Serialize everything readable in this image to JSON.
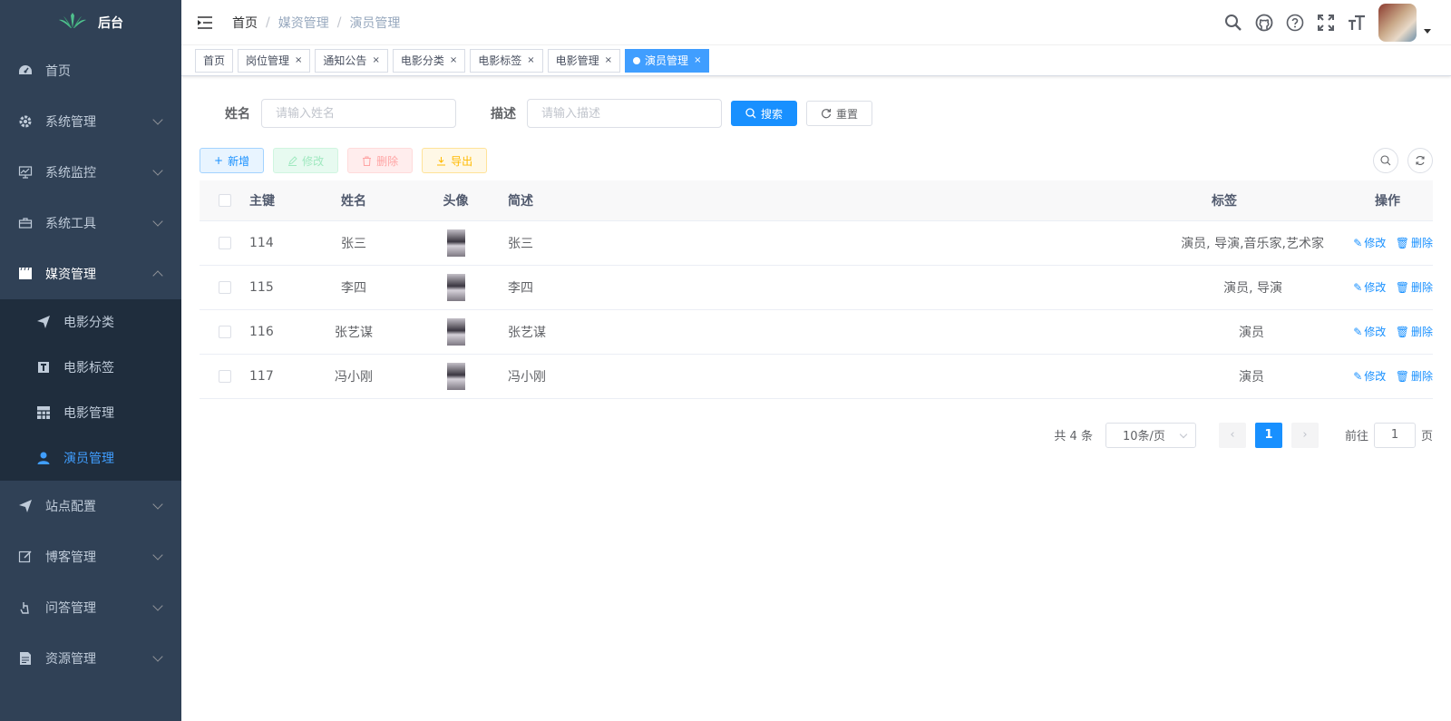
{
  "sidebar": {
    "logo_text": "后台",
    "items": [
      {
        "label": "首页",
        "icon": "dashboard-icon"
      },
      {
        "label": "系统管理",
        "icon": "gear-icon"
      },
      {
        "label": "系统监控",
        "icon": "monitor-icon"
      },
      {
        "label": "系统工具",
        "icon": "toolbox-icon"
      },
      {
        "label": "媒资管理",
        "icon": "clapperboard-icon"
      },
      {
        "label": "站点配置",
        "icon": "paper-plane-icon"
      },
      {
        "label": "博客管理",
        "icon": "edit-icon"
      },
      {
        "label": "问答管理",
        "icon": "hand-icon"
      },
      {
        "label": "资源管理",
        "icon": "document-icon"
      }
    ],
    "sub_items": [
      {
        "label": "电影分类",
        "icon": "paper-plane-icon"
      },
      {
        "label": "电影标签",
        "icon": "text-icon"
      },
      {
        "label": "电影管理",
        "icon": "grid-icon"
      },
      {
        "label": "演员管理",
        "icon": "user-icon"
      }
    ]
  },
  "navbar": {
    "breadcrumb": [
      "首页",
      "媒资管理",
      "演员管理"
    ],
    "icons": [
      "search-icon",
      "github-icon",
      "question-icon",
      "fullscreen-icon",
      "font-size-icon"
    ]
  },
  "tags": [
    "首页",
    "岗位管理",
    "通知公告",
    "电影分类",
    "电影标签",
    "电影管理",
    "演员管理"
  ],
  "search": {
    "name_label": "姓名",
    "name_placeholder": "请输入姓名",
    "desc_label": "描述",
    "desc_placeholder": "请输入描述",
    "search_button": "搜索",
    "reset_button": "重置"
  },
  "toolbar": {
    "add": "新增",
    "edit": "修改",
    "delete": "删除",
    "export": "导出"
  },
  "table": {
    "headers": {
      "id": "主键",
      "name": "姓名",
      "avatar": "头像",
      "brief": "简述",
      "tags": "标签",
      "actions": "操作"
    },
    "rows": [
      {
        "id": "114",
        "name": "张三",
        "brief": "张三",
        "tags": "演员, 导演,音乐家,艺术家"
      },
      {
        "id": "115",
        "name": "李四",
        "brief": "李四",
        "tags": "演员, 导演"
      },
      {
        "id": "116",
        "name": "张艺谋",
        "brief": "张艺谋",
        "tags": "演员"
      },
      {
        "id": "117",
        "name": "冯小刚",
        "brief": "冯小刚",
        "tags": "演员"
      }
    ],
    "edit_link": "修改",
    "delete_link": "删除"
  },
  "pagination": {
    "total_text": "共 4 条",
    "page_size": "10条/页",
    "current_page": "1",
    "goto_label": "前往",
    "goto_value": "1",
    "page_suffix": "页"
  },
  "colors": {
    "sidebar_bg": "#304156",
    "submenu_bg": "#1f2d3d",
    "primary": "#1890ff"
  }
}
